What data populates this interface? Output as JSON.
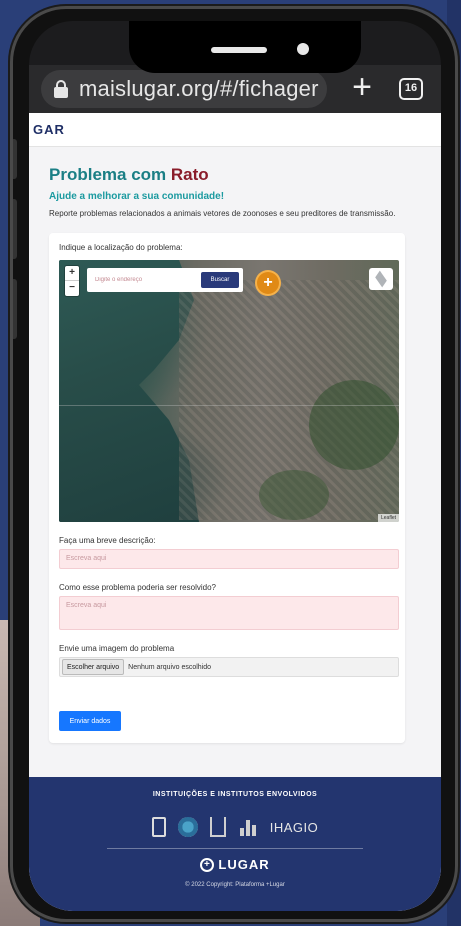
{
  "browser": {
    "url": "maislugar.org/#/fichager",
    "tab_count": "16"
  },
  "site": {
    "brand": "GAR"
  },
  "form": {
    "title_main": "Problema com",
    "title_accent": "Rato",
    "subtitle": "Ajude a melhorar a sua comunidade!",
    "description": "Reporte problemas relacionados a animais vetores de zoonoses e seu preditores de transmissão.",
    "location_label": "Indique a localização do problema:",
    "map": {
      "search_placeholder": "Digite o endereço",
      "search_button": "Buscar",
      "zoom_in": "+",
      "zoom_out": "−",
      "attribution": "Leaflet"
    },
    "description_label": "Faça uma breve descrição:",
    "description_placeholder": "Escreva aqui",
    "solution_label": "Como esse problema poderia ser resolvido?",
    "solution_placeholder": "Escreva aqui",
    "image_label": "Envie uma imagem do problema",
    "file_button": "Escolher arquivo",
    "file_none": "Nenhum arquivo escolhido",
    "submit": "Enviar dados"
  },
  "footer": {
    "heading": "INSTITUIÇÕES E INSTITUTOS ENVOLVIDOS",
    "partner_text": "IHAGIO",
    "logo_text": "LUGAR",
    "copyright": "© 2022 Copyright: Plataforma +Lugar"
  },
  "colors": {
    "title": "#1b7f85",
    "accent": "#8a1c2a",
    "submit": "#1677ff",
    "footer_bg": "#23356f"
  }
}
